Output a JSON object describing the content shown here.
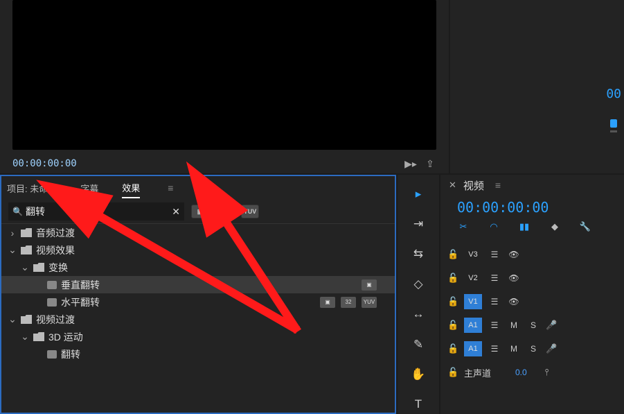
{
  "monitor": {
    "timecode": "00:00:00:00"
  },
  "timeline_top": {
    "timecode_fragment": "00"
  },
  "panel_tabs": {
    "project": "项目: 未命名",
    "subtitle": "字幕",
    "effects": "效果"
  },
  "search": {
    "value": "翻转"
  },
  "filter_badges": {
    "accelerated": "▣",
    "thirtytwo": "32",
    "yuv": "YUV"
  },
  "tree": {
    "audio_trans": "音频过渡",
    "video_effects": "视频效果",
    "transform": "变换",
    "vflip": "垂直翻转",
    "hflip": "水平翻转",
    "video_trans": "视频过渡",
    "three_d": "3D 运动",
    "flip": "翻转"
  },
  "tools": {
    "selection": "▸",
    "ripple": "⇥",
    "rolling": "⇆",
    "rate": "◇",
    "slip": "↔",
    "pen": "✎",
    "hand": "✋",
    "type": "T"
  },
  "timeline": {
    "title": "视频",
    "time": "00:00:00:00",
    "toolbar": {
      "scissors": "✂",
      "snap": "◠",
      "link": "▮▮",
      "marker": "◆",
      "wrench": "🔧"
    },
    "tracks": {
      "lock": "🔓",
      "v3": "V3",
      "v2": "V2",
      "v1": "V1",
      "a1": "A1",
      "a1b": "A1",
      "master": "主声道",
      "fx": "☰",
      "eye": "👁",
      "m": "M",
      "s": "S",
      "mic": "🎤",
      "zero": "0.0"
    }
  }
}
